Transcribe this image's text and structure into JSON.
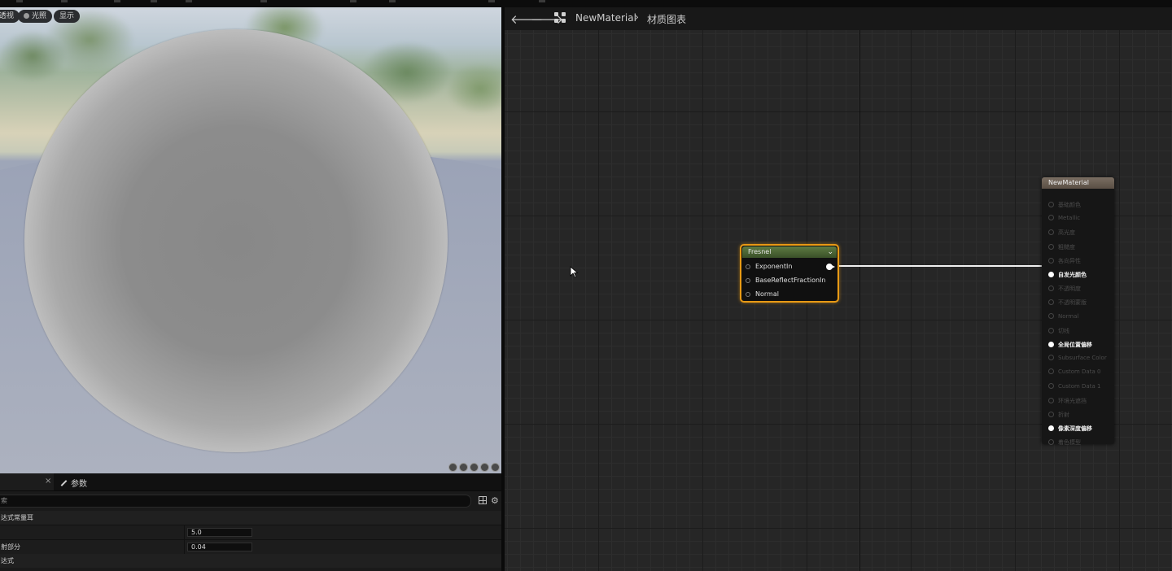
{
  "viewport": {
    "buttons": [
      {
        "label": "透视",
        "icon": ""
      },
      {
        "label": "光照",
        "icon": "light-icon"
      },
      {
        "label": "显示",
        "icon": ""
      }
    ]
  },
  "details": {
    "tab_param_label": "参数",
    "search_placeholder": "索",
    "category": "达式常量耳",
    "rows": [
      {
        "label": "",
        "value": "5.0"
      },
      {
        "label": "射部分",
        "value": "0.04"
      }
    ],
    "bottom_category": "达式"
  },
  "graph": {
    "breadcrumb": {
      "asset": "NewMaterial",
      "page": "材质图表"
    },
    "fresnel_node": {
      "title": "Fresnel",
      "inputs": [
        "ExponentIn",
        "BaseReflectFractionIn",
        "Normal"
      ]
    },
    "result_node": {
      "title": "NewMaterial",
      "pins": [
        {
          "label": "基础颜色",
          "active": false
        },
        {
          "label": "Metallic",
          "active": false
        },
        {
          "label": "高光度",
          "active": false
        },
        {
          "label": "粗糙度",
          "active": false
        },
        {
          "label": "各向异性",
          "active": false
        },
        {
          "label": "自发光颜色",
          "active": true
        },
        {
          "label": "不透明度",
          "active": false
        },
        {
          "label": "不透明蒙版",
          "active": false
        },
        {
          "label": "Normal",
          "active": false
        },
        {
          "label": "切线",
          "active": false
        },
        {
          "label": "全局位置偏移",
          "active": true
        },
        {
          "label": "Subsurface Color",
          "active": false
        },
        {
          "label": "Custom Data 0",
          "active": false
        },
        {
          "label": "Custom Data 1",
          "active": false
        },
        {
          "label": "环境光遮挡",
          "active": false
        },
        {
          "label": "折射",
          "active": false
        },
        {
          "label": "像素深度偏移",
          "active": true
        },
        {
          "label": "着色模型",
          "active": false
        }
      ]
    }
  }
}
